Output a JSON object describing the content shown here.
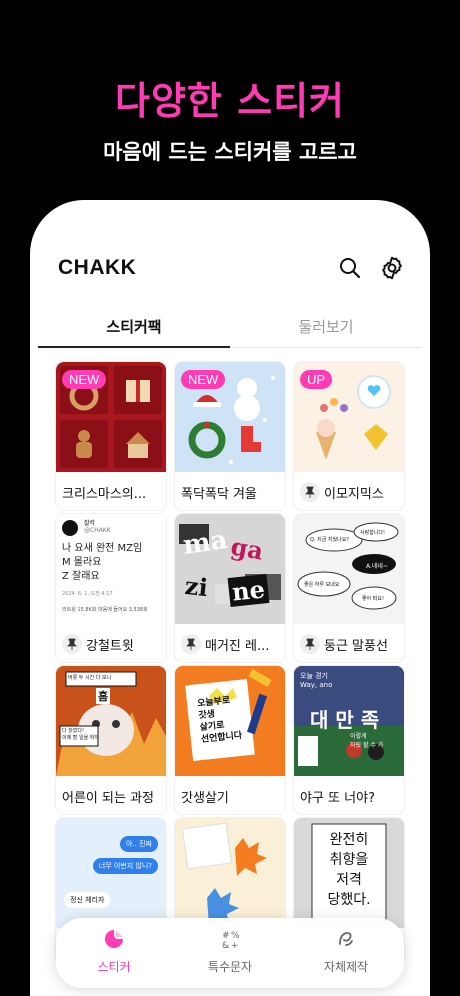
{
  "headline": "다양한 스티커",
  "subline": "마음에 드는 스티커를 고르고",
  "app": {
    "brand": "CHAKK",
    "tabs": [
      {
        "label": "스티커팩",
        "active": true
      },
      {
        "label": "둘러보기",
        "active": false
      }
    ]
  },
  "cards": [
    {
      "title": "크리스마스의...",
      "badge": "NEW",
      "pinned": false
    },
    {
      "title": "폭닥폭닥 겨울",
      "badge": "NEW",
      "pinned": false
    },
    {
      "title": "이모지믹스",
      "badge": "UP",
      "pinned": true
    },
    {
      "title": "강철트윗",
      "badge": "",
      "pinned": true
    },
    {
      "title": "매거진 레...",
      "badge": "",
      "pinned": true
    },
    {
      "title": "둥근 말풍선",
      "badge": "",
      "pinned": true
    },
    {
      "title": "어른이 되는 과정",
      "badge": "",
      "pinned": false
    },
    {
      "title": "갓생살기",
      "badge": "",
      "pinned": false
    },
    {
      "title": "야구 또 너야?",
      "badge": "",
      "pinned": false
    },
    {
      "title": "",
      "badge": "",
      "pinned": false
    },
    {
      "title": "",
      "badge": "",
      "pinned": false
    },
    {
      "title": "",
      "badge": "",
      "pinned": false
    }
  ],
  "tweet": {
    "handle": "@CHAKK",
    "name": "찰칵",
    "lines": [
      "나 요새 완전 MZ임",
      "M 몰라요",
      "Z 잘래요"
    ],
    "time": "2024. 6. 1. 오전 4:17",
    "stats": "리트윗 15.8K회   마음에 들어요 3,538회"
  },
  "magazine": [
    "ma",
    "ga",
    "zi",
    "ne"
  ],
  "bubbles": [
    "Q. 지금 지웠나요?",
    "사랑합니다!",
    "A.네네~",
    "좋은 하루 보내요",
    "좋아 떠요!"
  ],
  "cat": {
    "top": "버릇 두 시간 다 보니",
    "big": "흠",
    "bottom": "다 늙었다!\n이제 할 일을 하자"
  },
  "godlife": {
    "note": "오늘부로\n갓생\n살기로\n선언합니다"
  },
  "baseball": {
    "top": "오늘 경기\nWay, ano",
    "big": "대 만 족",
    "sub": "이렇게\n자릿 할 수 가"
  },
  "chat": {
    "a": "아.. 진짜",
    "b": "너무 이번지 않니?",
    "c": "정신 체리자"
  },
  "book": {
    "text": "완전히\n취향을\n저격\n당했다."
  },
  "bottom_nav": [
    {
      "label": "스티커",
      "icon": "sticker-icon",
      "active": true
    },
    {
      "label": "특수문자",
      "icon": "special-chars-icon",
      "active": false
    },
    {
      "label": "자체제작",
      "icon": "custom-make-icon",
      "active": false
    }
  ],
  "colors": {
    "accent": "#ff3cb4",
    "background": "#000000"
  }
}
